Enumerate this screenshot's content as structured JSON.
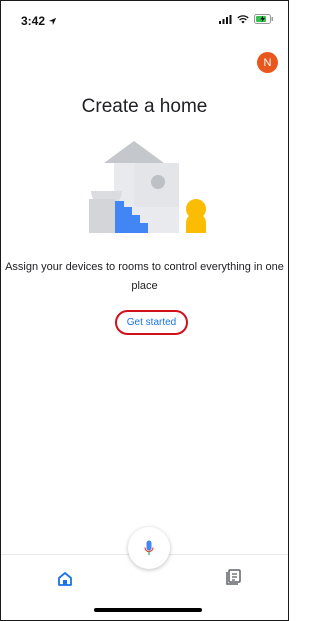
{
  "status_bar": {
    "time": "3:42",
    "icons": [
      "location-arrow-icon",
      "signal-icon",
      "wifi-icon",
      "battery-charging-icon"
    ]
  },
  "account": {
    "initial": "N",
    "color": "#e8571e"
  },
  "main": {
    "title": "Create a home",
    "description": "Assign your devices to rooms to control everything in one place",
    "cta_label": "Get started"
  },
  "bottom_nav": {
    "items": [
      {
        "icon": "home-icon",
        "active": true
      },
      {
        "icon": "feed-icon",
        "active": false
      }
    ],
    "mic_icon": "mic-icon"
  },
  "colors": {
    "accent": "#1a73e8",
    "highlight": "#d0101b",
    "illustration_gray": "#dadce0",
    "illustration_blue": "#4285f4",
    "illustration_yellow": "#fbbc04"
  }
}
